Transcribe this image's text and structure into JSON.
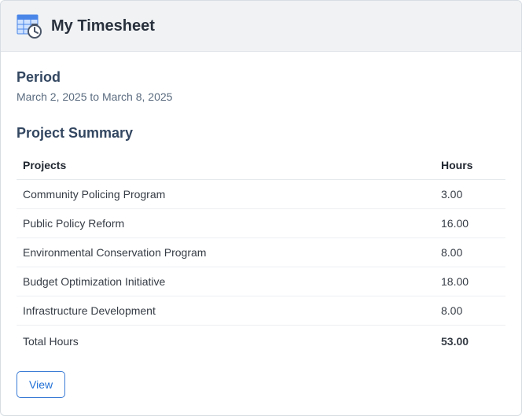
{
  "header": {
    "title": "My Timesheet"
  },
  "period": {
    "label": "Period",
    "value": "March 2, 2025 to March 8, 2025"
  },
  "summary": {
    "heading": "Project Summary",
    "columns": {
      "projects": "Projects",
      "hours": "Hours"
    },
    "rows": [
      {
        "project": "Community Policing Program",
        "hours": "3.00"
      },
      {
        "project": "Public Policy Reform",
        "hours": "16.00"
      },
      {
        "project": "Environmental Conservation Program",
        "hours": "8.00"
      },
      {
        "project": "Budget Optimization Initiative",
        "hours": "18.00"
      },
      {
        "project": "Infrastructure Development",
        "hours": "8.00"
      }
    ],
    "total_label": "Total Hours",
    "total_value": "53.00"
  },
  "actions": {
    "view": "View"
  }
}
